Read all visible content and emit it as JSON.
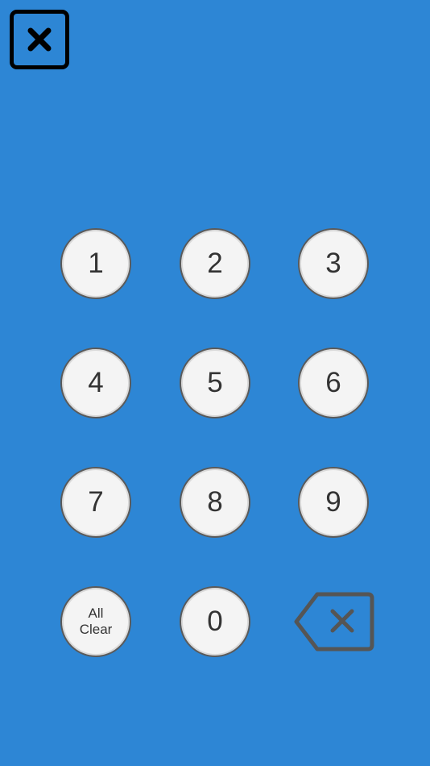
{
  "keypad": {
    "keys": [
      {
        "label": "1"
      },
      {
        "label": "2"
      },
      {
        "label": "3"
      },
      {
        "label": "4"
      },
      {
        "label": "5"
      },
      {
        "label": "6"
      },
      {
        "label": "7"
      },
      {
        "label": "8"
      },
      {
        "label": "9"
      },
      {
        "label": "All\nClear"
      },
      {
        "label": "0"
      }
    ]
  },
  "icons": {
    "close": "close-icon",
    "backspace": "backspace-icon"
  },
  "colors": {
    "background": "#2d86d5",
    "key_fill": "#f4f4f4",
    "key_text": "#333333",
    "close_icon": "#000000",
    "backspace_icon": "#555555"
  }
}
